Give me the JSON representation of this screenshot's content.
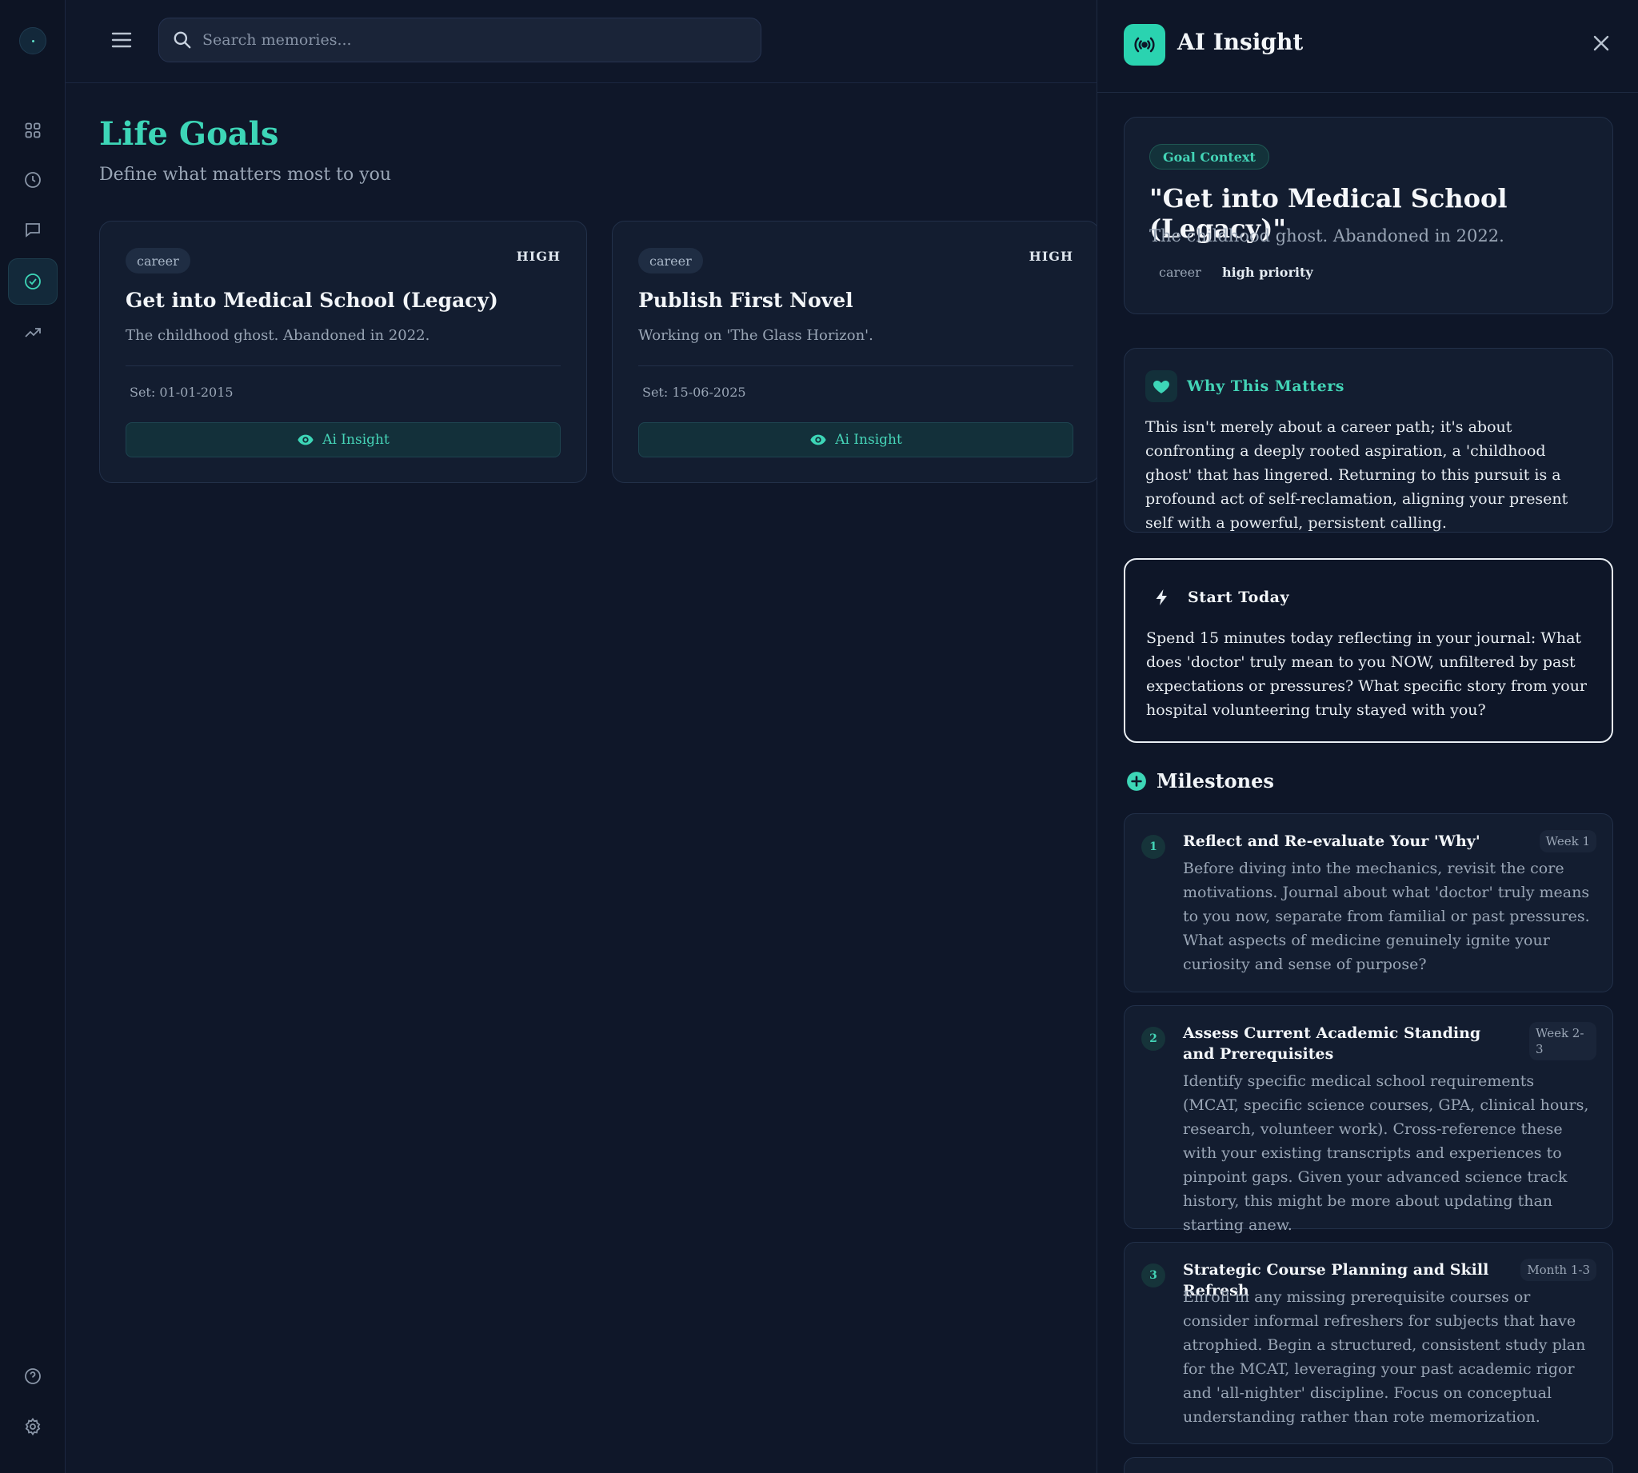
{
  "search": {
    "placeholder": "Search memories..."
  },
  "page": {
    "title": "Life Goals",
    "subtitle": "Define what matters most to you"
  },
  "goals": [
    {
      "category": "career",
      "priority": "HIGH",
      "title": "Get into Medical School (Legacy)",
      "description": "The childhood ghost. Abandoned in 2022.",
      "date": "Set: 01-01-2015",
      "button": "Ai Insight"
    },
    {
      "category": "career",
      "priority": "HIGH",
      "title": "Publish First Novel",
      "description": "Working on 'The Glass Horizon'.",
      "date": "Set: 15-06-2025",
      "button": "Ai Insight"
    }
  ],
  "panel": {
    "title": "AI Insight",
    "context": {
      "badge": "Goal Context",
      "title": "\"Get into Medical School (Legacy)\"",
      "description": "The childhood ghost. Abandoned in 2022.",
      "category": "career",
      "priority": "high priority"
    },
    "why": {
      "label": "Why This Matters",
      "text": "This isn't merely about a career path; it's about confronting a deeply rooted aspiration, a 'childhood ghost' that has lingered. Returning to this pursuit is a profound act of self-reclamation, aligning your present self with a powerful, persistent calling."
    },
    "start": {
      "label": "Start Today",
      "text": "Spend 15 minutes today reflecting in your journal: What does 'doctor' truly mean to you NOW, unfiltered by past expectations or pressures? What specific story from your hospital volunteering truly stayed with you?"
    },
    "milestones_label": "Milestones",
    "milestones": [
      {
        "num": "1",
        "title": "Reflect and Re-evaluate Your 'Why'",
        "when": "Week 1",
        "text": "Before diving into the mechanics, revisit the core motivations. Journal about what 'doctor' truly means to you now, separate from familial or past pressures. What aspects of medicine genuinely ignite your curiosity and sense of purpose?"
      },
      {
        "num": "2",
        "title": "Assess Current Academic Standing and Prerequisites",
        "when": "Week 2-3",
        "text": "Identify specific medical school requirements (MCAT, specific science courses, GPA, clinical hours, research, volunteer work). Cross-reference these with your existing transcripts and experiences to pinpoint gaps. Given your advanced science track history, this might be more about updating than starting anew."
      },
      {
        "num": "3",
        "title": "Strategic Course Planning and Skill Refresh",
        "when": "Month 1-3",
        "text": "Enroll in any missing prerequisite courses or consider informal refreshers for subjects that have atrophied. Begin a structured, consistent study plan for the MCAT, leveraging your past academic rigor and 'all-nighter' discipline. Focus on conceptual understanding rather than rote memorization."
      }
    ]
  },
  "colors": {
    "accent": "#3dd6b7",
    "background": "#0f1729",
    "card": "#131d30"
  },
  "icons": {
    "rail": [
      "logo",
      "grid-icon",
      "clock-icon",
      "chat-icon",
      "check-circle-icon",
      "trending-icon",
      "help-icon",
      "gear-icon"
    ]
  }
}
